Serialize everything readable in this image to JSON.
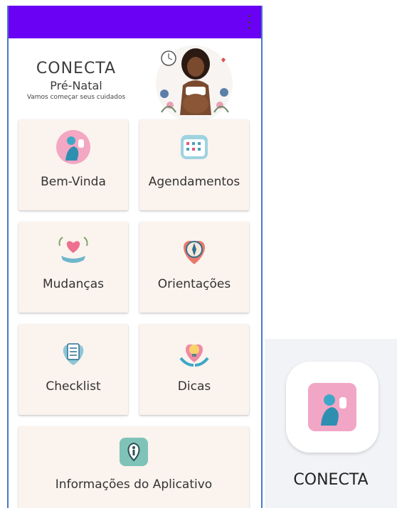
{
  "header": {
    "title": "CONECTA",
    "subtitle": "Pré-Natal",
    "tagline": "Vamos começar seus cuidados"
  },
  "menu": {
    "items": [
      {
        "label": "Bem-Vinda",
        "icon": "pregnant-mother-icon"
      },
      {
        "label": "Agendamentos",
        "icon": "calendar-icon"
      },
      {
        "label": "Mudanças",
        "icon": "heart-hand-icon"
      },
      {
        "label": "Orientações",
        "icon": "compass-heart-icon"
      },
      {
        "label": "Checklist",
        "icon": "clipboard-heart-icon"
      },
      {
        "label": "Dicas",
        "icon": "lightbulb-hands-icon"
      }
    ],
    "info": {
      "label": "Informações do Aplicativo",
      "icon": "info-location-icon"
    }
  },
  "launcher": {
    "app_name": "CONECTA"
  },
  "colors": {
    "topbar": "#6a00f4",
    "card": "#fbf3ee",
    "text": "#333333"
  }
}
